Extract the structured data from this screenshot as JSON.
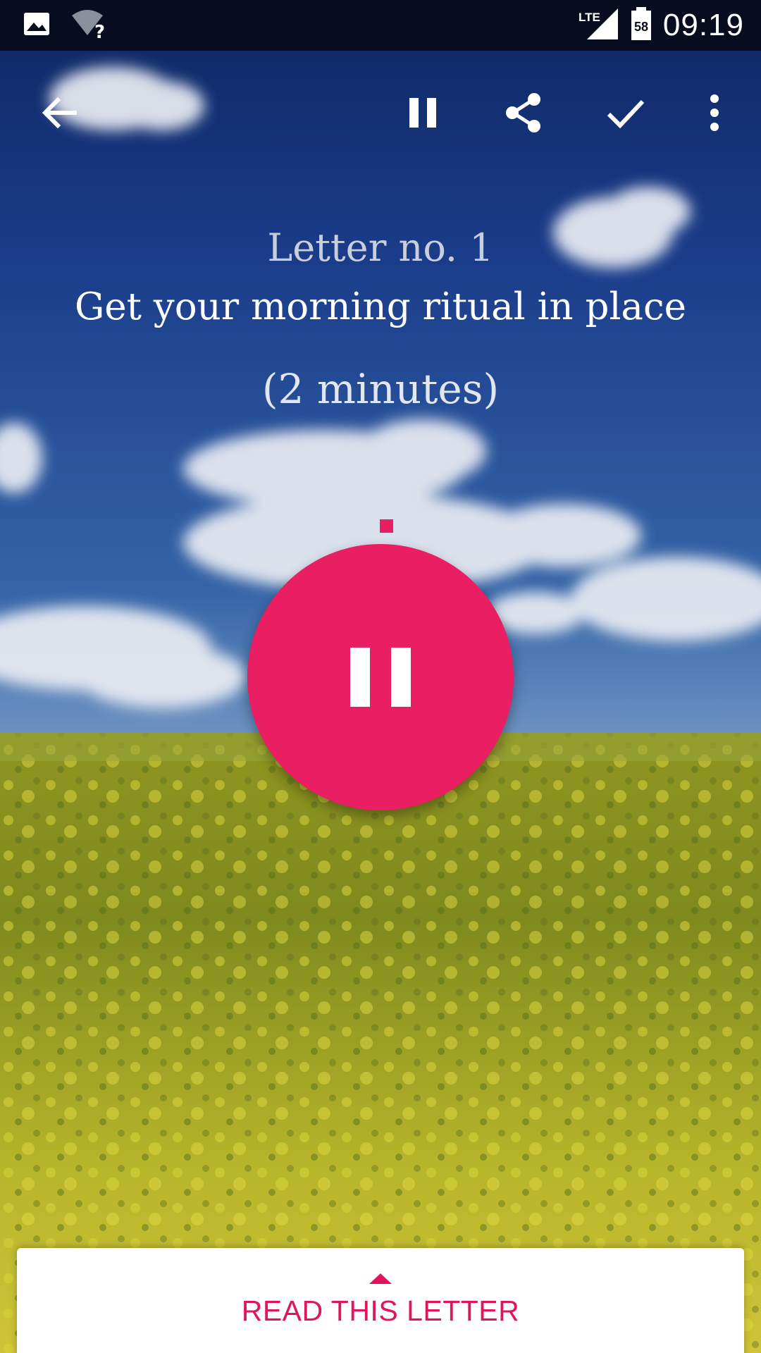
{
  "status_bar": {
    "time": "09:19",
    "network": "LTE",
    "battery_level": "58",
    "icons": [
      "image-notification-icon",
      "wifi-unknown-icon",
      "lte-signal-icon",
      "battery-icon"
    ]
  },
  "toolbar": {
    "icons": [
      "back-arrow-icon",
      "pause-icon",
      "share-icon",
      "check-icon",
      "more-vert-icon"
    ]
  },
  "letter": {
    "number_label": "Letter no. 1",
    "title": "Get your morning ritual in place",
    "duration": "(2 minutes)",
    "playback_state": "playing"
  },
  "bottom_card": {
    "label": "READ THIS LETTER"
  },
  "colors": {
    "accent": "#e91e63",
    "status_bar": "#070d1f",
    "sky": "#1d3f8f",
    "field": "#a8a828"
  }
}
